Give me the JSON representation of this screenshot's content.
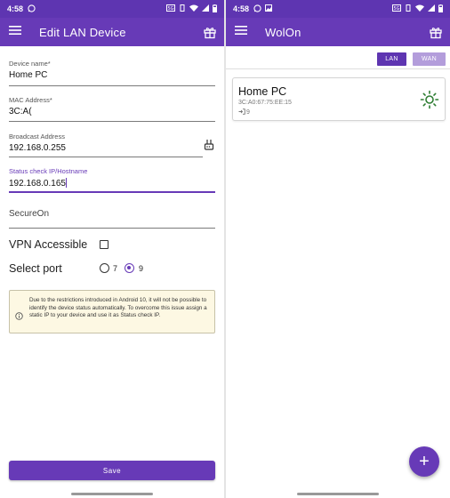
{
  "left_screen": {
    "status_bar": {
      "time": "4:58"
    },
    "app_bar": {
      "title": "Edit LAN Device"
    },
    "fields": {
      "device_name": {
        "label": "Device name*",
        "value": "Home PC"
      },
      "mac_address": {
        "label": "MAC Address*",
        "value": "3C:A("
      },
      "broadcast_address": {
        "label": "Broadcast Address",
        "value": "192.168.0.255"
      },
      "status_check": {
        "label": "Status check IP/Hostname",
        "value": "192.168.0.165"
      },
      "secure_on": {
        "placeholder": "SecureOn",
        "value": ""
      }
    },
    "vpn": {
      "label": "VPN Accessible",
      "checked": false
    },
    "port": {
      "label": "Select port",
      "options": [
        {
          "value": "7",
          "selected": false
        },
        {
          "value": "9",
          "selected": true
        }
      ]
    },
    "notice": "Due to the restrictions introduced in Android 10, it will not be possible to identify the device status automatically. To overcome this issue assign a static IP to your device and use it as Status check IP.",
    "save_label": "Save"
  },
  "right_screen": {
    "status_bar": {
      "time": "4:58"
    },
    "app_bar": {
      "title": "WolOn"
    },
    "toggle": {
      "lan_label": "LAN",
      "wan_label": "WAN",
      "selected": "LAN"
    },
    "devices": [
      {
        "name": "Home PC",
        "mac": "3C:A0:67:75:EE:15",
        "port": "9",
        "status": "online"
      }
    ],
    "fab_label": "+"
  },
  "colors": {
    "primary": "#673ab7",
    "status_bar": "#5e35b1",
    "wan_inactive": "#b39ddb",
    "online": "#2e7d32",
    "notice_bg": "#fdf8e3"
  },
  "icons": {
    "menu": "hamburger-icon",
    "gift": "gift-icon",
    "router": "router-icon",
    "info": "info-icon",
    "status": "sun-online-icon",
    "port": "login-arrow-icon"
  }
}
